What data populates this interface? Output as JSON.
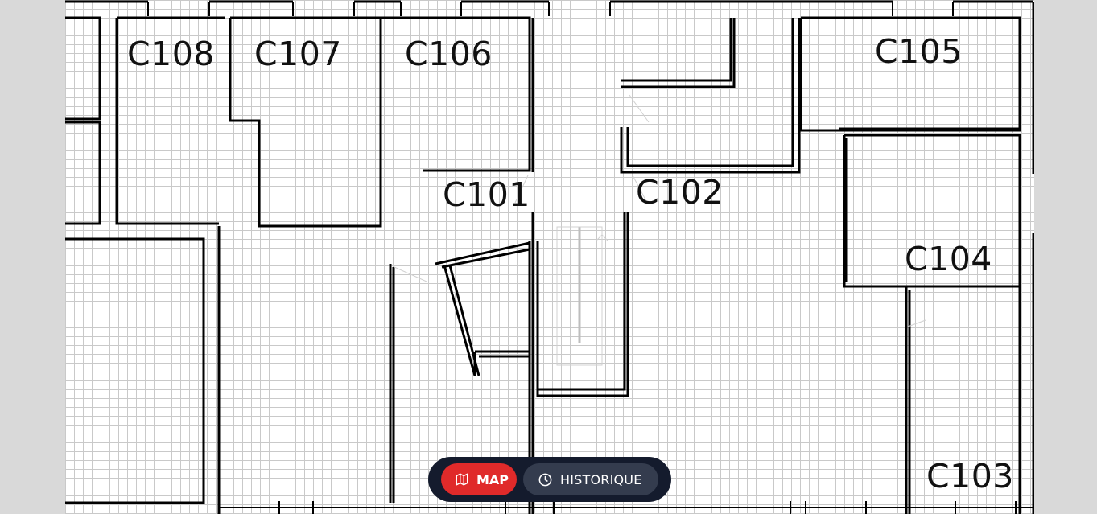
{
  "rooms": {
    "c108": "C108",
    "c107": "C107",
    "c106": "C106",
    "c105": "C105",
    "c101": "C101",
    "c102": "C102",
    "c104": "C104",
    "c103": "C103"
  },
  "nav": {
    "map_label": "MAP",
    "history_label": "HISTORIQUE",
    "map_icon": "map-icon",
    "history_icon": "clock-icon",
    "active_color": "#e02a2a",
    "bar_color": "#141b2d"
  }
}
